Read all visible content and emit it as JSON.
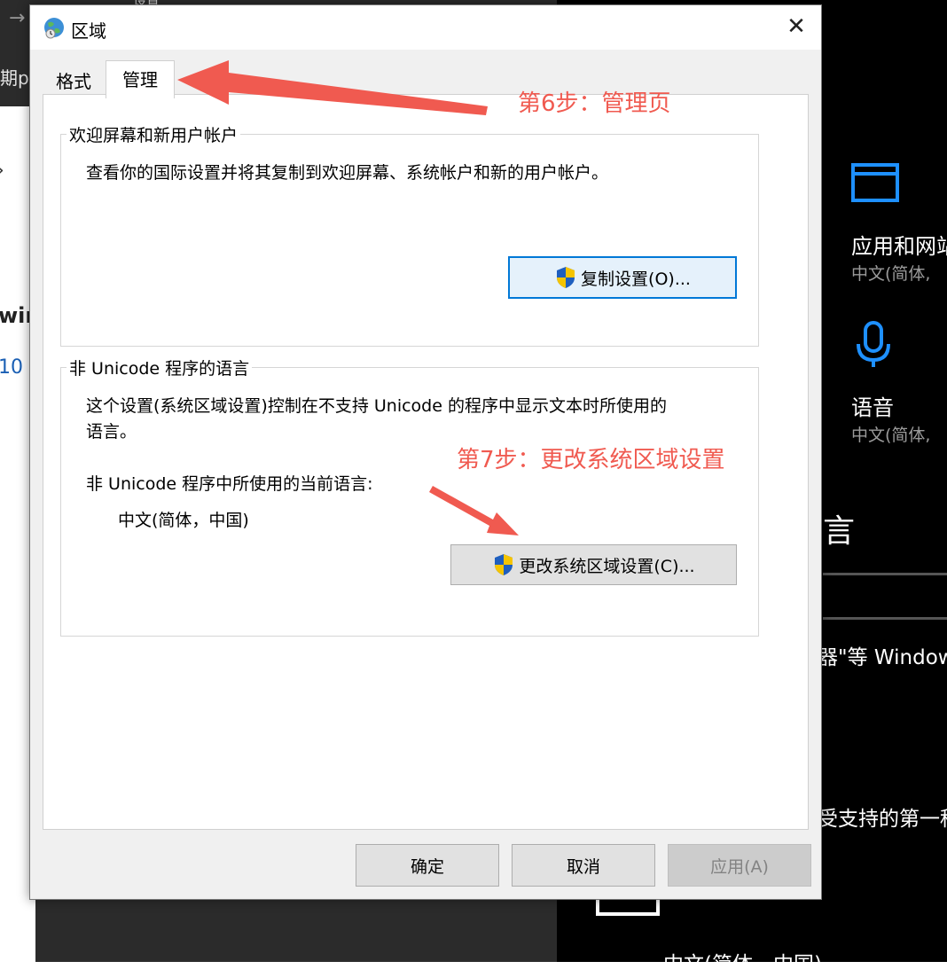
{
  "background": {
    "top_title": "设置",
    "left_tab_text": "期p",
    "left_bold": "wir",
    "left_link": "10",
    "right_items": [
      {
        "title": "应用和网站",
        "sub": "中文(简体,"
      },
      {
        "title": "语音",
        "sub": "中文(简体,"
      }
    ],
    "right_big": "言",
    "right_text1": "器\"等 Windows",
    "right_text2": "受支持的第一种",
    "right_bottom": "中文(简体，中国)"
  },
  "dialog": {
    "title": "区域",
    "close_glyph": "✕",
    "tabs": [
      "格式",
      "管理"
    ],
    "active_tab": "管理",
    "welcome_group": {
      "legend": "欢迎屏幕和新用户帐户",
      "description": "查看你的国际设置并将其复制到欢迎屏幕、系统帐户和新的用户帐户。",
      "copy_button": "复制设置(O)..."
    },
    "unicode_group": {
      "legend": "非 Unicode 程序的语言",
      "description_line1": "这个设置(系统区域设置)控制在不支持 Unicode 的程序中显示文本时所使用的",
      "description_line2": "语言。",
      "current_label": "非 Unicode 程序中所使用的当前语言:",
      "current_value": "中文(简体，中国)",
      "change_button": "更改系统区域设置(C)..."
    },
    "buttons": {
      "ok": "确定",
      "cancel": "取消",
      "apply": "应用(A)"
    }
  },
  "annotations": {
    "step6": "第6步：管理页",
    "step7": "第7步：更改系统区域设置"
  },
  "colors": {
    "annotation": "#f05a50",
    "focus_border": "#0078d7",
    "right_icon": "#1e90ff"
  }
}
